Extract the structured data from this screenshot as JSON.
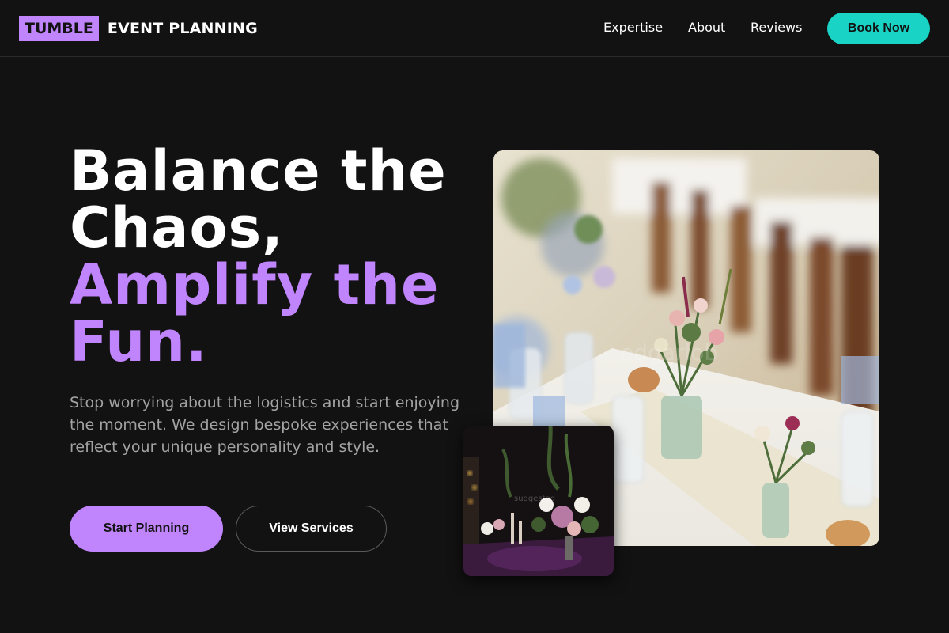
{
  "header": {
    "logo_badge": "TUMBLE",
    "logo_text": "EVENT PLANNING",
    "nav": [
      "Expertise",
      "About",
      "Reviews"
    ],
    "book_label": "Book Now"
  },
  "hero": {
    "headline_line1": "Balance the",
    "headline_line2": "Chaos,",
    "headline_line3": "Amplify the",
    "headline_line4": "Fun.",
    "description": "Stop worrying about the logistics and start enjoying the moment. We design bespoke experiences that reflect your unique personality and style.",
    "primary_cta": "Start Planning",
    "secondary_cta": "View Services"
  },
  "colors": {
    "background": "#121212",
    "accent_purple": "#c084fc",
    "accent_teal": "#19d3c5",
    "muted_text": "#a3a3a3"
  },
  "icons": {
    "main_image": "wedding-table-photo",
    "small_image": "floral-arrangement-photo"
  }
}
